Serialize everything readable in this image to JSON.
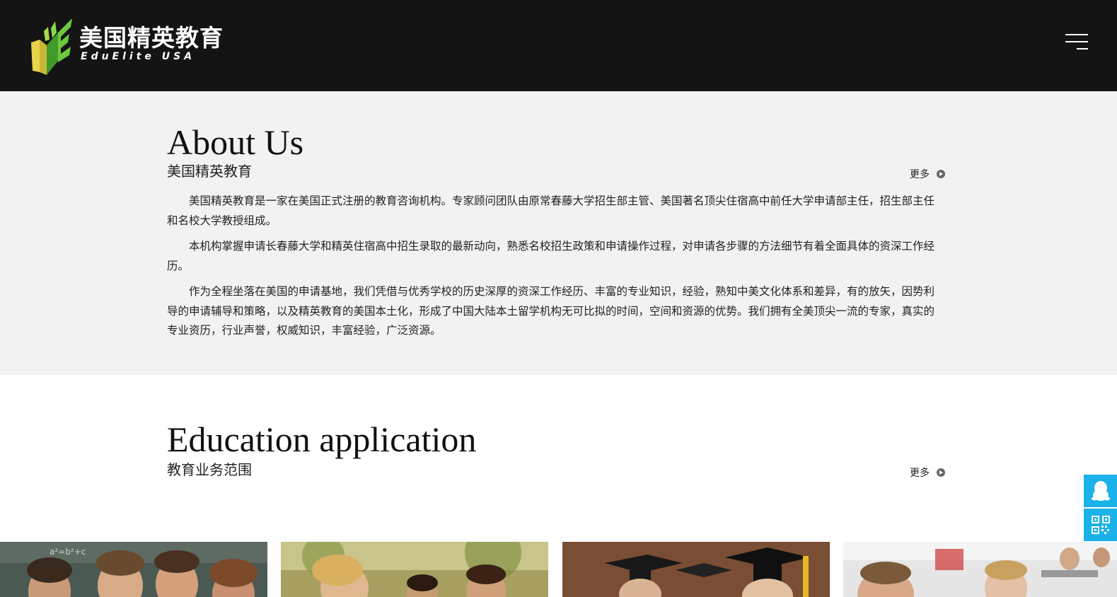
{
  "header": {
    "logo": {
      "cn": "美国精英教育",
      "en": "EduElite USA",
      "icon": "book-leaf-logo-icon"
    },
    "menu_icon": "hamburger-menu-icon"
  },
  "about": {
    "title": "About Us",
    "subtitle": "美国精英教育",
    "more_label": "更多",
    "more_icon": "circle-arrow-right-icon",
    "paragraphs": [
      "美国精英教育是一家在美国正式注册的教育咨询机构。专家顾问团队由原常春藤大学招生部主管、美国著名顶尖住宿高中前任大学申请部主任，招生部主任和名校大学教授组成。",
      "本机构掌握申请长春藤大学和精英住宿高中招生录取的最新动向，熟悉名校招生政策和申请操作过程，对申请各步骤的方法细节有着全面具体的资深工作经历。",
      "作为全程坐落在美国的申请基地，我们凭借与优秀学校的历史深厚的资深工作经历、丰富的专业知识，经验，熟知中美文化体系和差异，有的放矢，因势利导的申请辅导和策略，以及精英教育的美国本土化，形成了中国大陆本土留学机构无可比拟的时间，空间和资源的优势。我们拥有全美顶尖一流的专家，真实的专业资历，行业声誉，权威知识，丰富经验，广泛资源。"
    ]
  },
  "education": {
    "title": "Education application",
    "subtitle": "教育业务范围",
    "more_label": "更多",
    "photos": [
      {
        "name": "students-classroom-photo"
      },
      {
        "name": "students-outdoors-photo"
      },
      {
        "name": "graduation-caps-photo"
      },
      {
        "name": "students-laptops-photo"
      }
    ]
  },
  "side_float": {
    "qq_icon": "qq-penguin-icon",
    "qr_icon": "qr-code-icon"
  },
  "colors": {
    "header_bg": "#141414",
    "about_bg": "#f2f2f2",
    "float_accent": "#1ab2e8",
    "logo_green": "#5cb82e",
    "logo_yellow": "#e8d34a"
  }
}
